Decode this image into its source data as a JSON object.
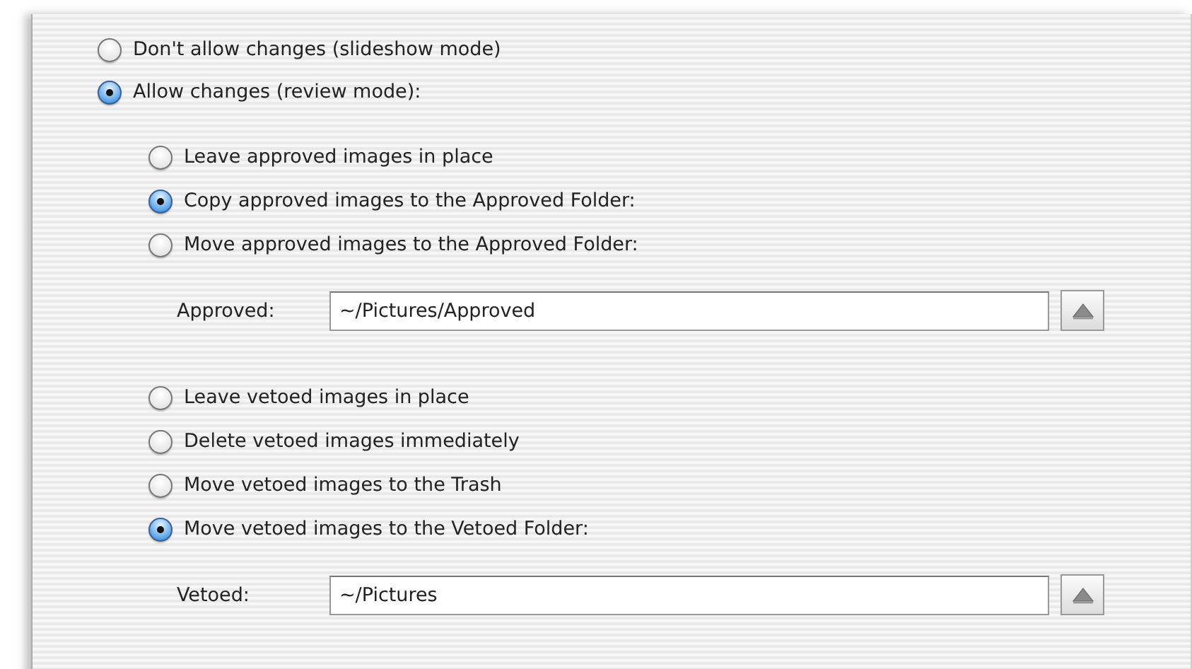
{
  "mode_options": [
    {
      "label": "Don't allow changes (slideshow mode)",
      "selected": false
    },
    {
      "label": "Allow changes (review mode):",
      "selected": true
    }
  ],
  "approved_options": [
    {
      "label": "Leave approved images in place",
      "selected": false
    },
    {
      "label": "Copy approved images to the Approved Folder:",
      "selected": true
    },
    {
      "label": "Move approved images to the Approved Folder:",
      "selected": false
    }
  ],
  "approved_field": {
    "label": "Approved:",
    "value": "~/Pictures/Approved"
  },
  "vetoed_options": [
    {
      "label": "Leave vetoed images in place",
      "selected": false
    },
    {
      "label": "Delete vetoed images immediately",
      "selected": false
    },
    {
      "label": "Move vetoed images to the Trash",
      "selected": false
    },
    {
      "label": "Move vetoed images to the Vetoed Folder:",
      "selected": true
    }
  ],
  "vetoed_field": {
    "label": "Vetoed:",
    "value": "~/Pictures"
  }
}
